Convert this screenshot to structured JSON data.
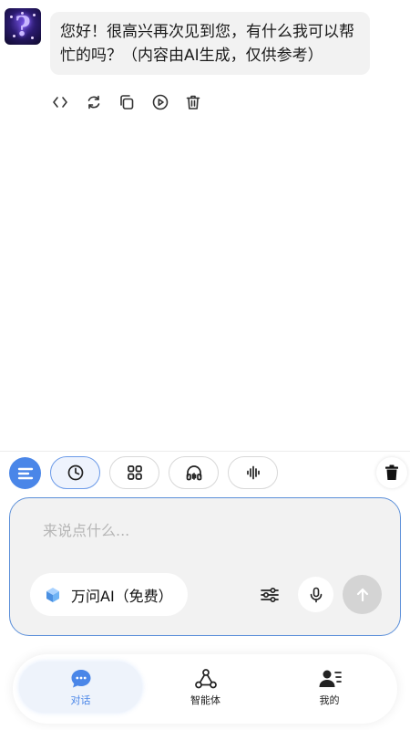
{
  "chat": {
    "assistant_avatar_icon": "question-mark-avatar-icon",
    "message_line_1": "您好！很高兴再次见到您，有什么我可以帮",
    "message_line_2": "忙的吗？（内容由AI生成，仅供参考）",
    "actions": [
      "code-icon",
      "refresh-icon",
      "copy-icon",
      "play-icon",
      "delete-icon"
    ]
  },
  "toolbar": {
    "items": [
      "menu-icon",
      "history-icon",
      "apps-grid-icon",
      "headphones-icon",
      "voice-wave-icon"
    ],
    "clear_icon": "trash-icon"
  },
  "composer": {
    "placeholder": "来说点什么...",
    "model_label": "万问AI（免费）",
    "model_icon": "cube-icon",
    "settings_icon": "sliders-icon",
    "mic_icon": "microphone-icon",
    "send_icon": "arrow-up-icon"
  },
  "nav": {
    "items": [
      {
        "label": "对话",
        "icon": "chat-bubble-icon",
        "active": true
      },
      {
        "label": "智能体",
        "icon": "agent-nodes-icon",
        "active": false
      },
      {
        "label": "我的",
        "icon": "profile-icon",
        "active": false
      }
    ]
  },
  "colors": {
    "accent": "#4a86e8",
    "bubble_bg": "#f2f2f2",
    "input_border": "#5b8fd9",
    "send_disabled": "#d4d4d4"
  }
}
